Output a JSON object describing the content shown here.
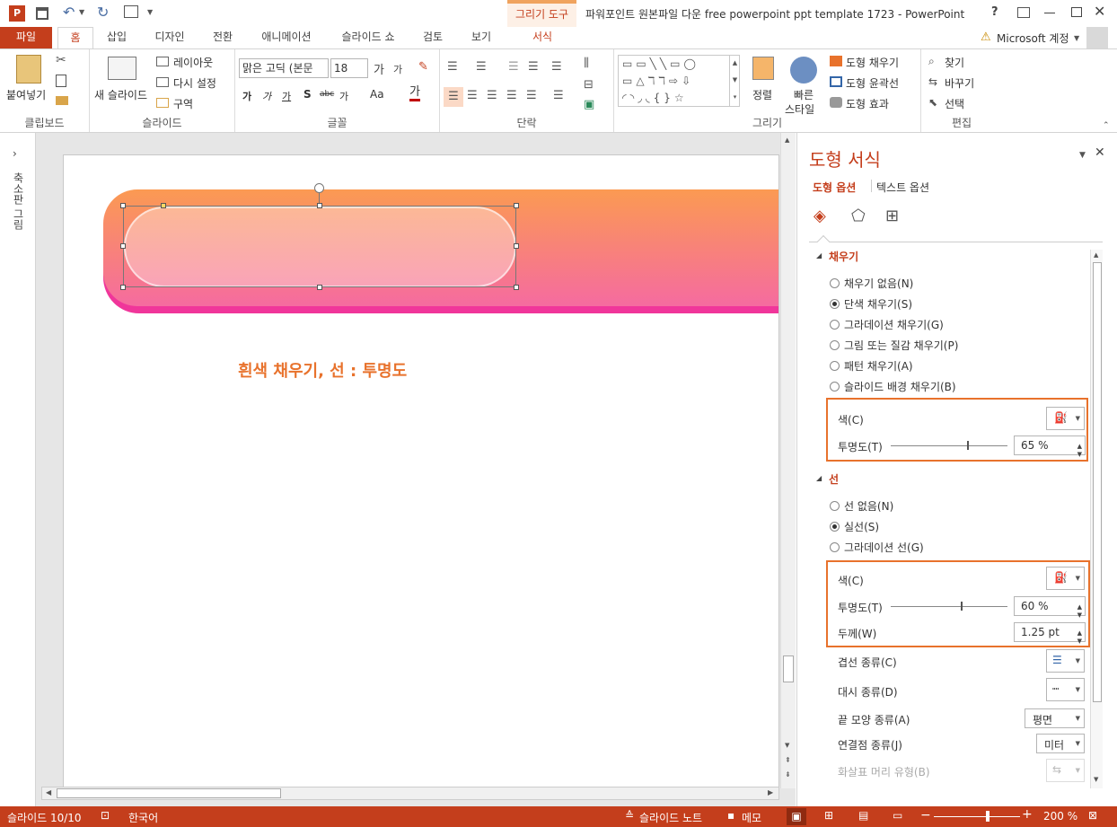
{
  "titlebar": {
    "context_group": "그리기 도구",
    "window_title": "파워포인트 원본파일 다운 free powerpoint ppt template 1723 - PowerPoint",
    "help": "?",
    "account": "Microsoft 계정"
  },
  "tabs": [
    "파일",
    "홈",
    "삽입",
    "디자인",
    "전환",
    "애니메이션",
    "슬라이드 쇼",
    "검토",
    "보기",
    "서식"
  ],
  "ribbon": {
    "clipboard": {
      "paste": "붙여넣기",
      "label": "클립보드"
    },
    "slides": {
      "new_slide": "새 슬라이드",
      "layout": "레이아웃",
      "reset": "다시 설정",
      "section": "구역",
      "label": "슬라이드"
    },
    "font": {
      "font_name": "맑은 고딕 (본문",
      "font_size": "18",
      "label": "글꼴"
    },
    "paragraph": {
      "label": "단락"
    },
    "drawing": {
      "arrange": "정렬",
      "quick_styles_1": "빠른",
      "quick_styles_2": "스타일",
      "fill": "도형 채우기",
      "outline": "도형 윤곽선",
      "effects": "도형 효과",
      "label": "그리기"
    },
    "editing": {
      "find": "찾기",
      "replace": "바꾸기",
      "select": "선택",
      "label": "편집"
    }
  },
  "thumbs_label": "축소판 그림",
  "slide": {
    "caption": "흰색 채우기, 선 : 투명도"
  },
  "panel": {
    "title": "도형 서식",
    "tab_shape": "도형 옵션",
    "tab_text": "텍스트 옵션",
    "fill_header": "채우기",
    "fill_options": [
      "채우기 없음(N)",
      "단색 채우기(S)",
      "그라데이션 채우기(G)",
      "그림 또는 질감 채우기(P)",
      "패턴 채우기(A)",
      "슬라이드 배경 채우기(B)"
    ],
    "fill_selected": 1,
    "fill_color_label": "색(C)",
    "fill_transparency_label": "투명도(T)",
    "fill_transparency_value": "65 %",
    "fill_transparency_pct": 65,
    "line_header": "선",
    "line_options": [
      "선 없음(N)",
      "실선(S)",
      "그라데이션 선(G)"
    ],
    "line_selected": 1,
    "line_color_label": "색(C)",
    "line_transparency_label": "투명도(T)",
    "line_transparency_value": "60 %",
    "line_transparency_pct": 60,
    "width_label": "두께(W)",
    "width_value": "1.25 pt",
    "compound_label": "겹선 종류(C)",
    "dash_label": "대시 종류(D)",
    "cap_label": "끝 모양 종류(A)",
    "cap_value": "평면",
    "join_label": "연결점 종류(J)",
    "join_value": "미터",
    "arrow_label": "화살표 머리 유형(B)"
  },
  "status": {
    "slide_info": "슬라이드 10/10",
    "language": "한국어",
    "notes": "슬라이드 노트",
    "comments": "메모",
    "zoom": "200 %"
  },
  "colors": {
    "accent": "#c43e1c",
    "highlight": "#e8722c",
    "banner_top": "#fb9a52",
    "banner_bottom": "#f56ba0"
  }
}
